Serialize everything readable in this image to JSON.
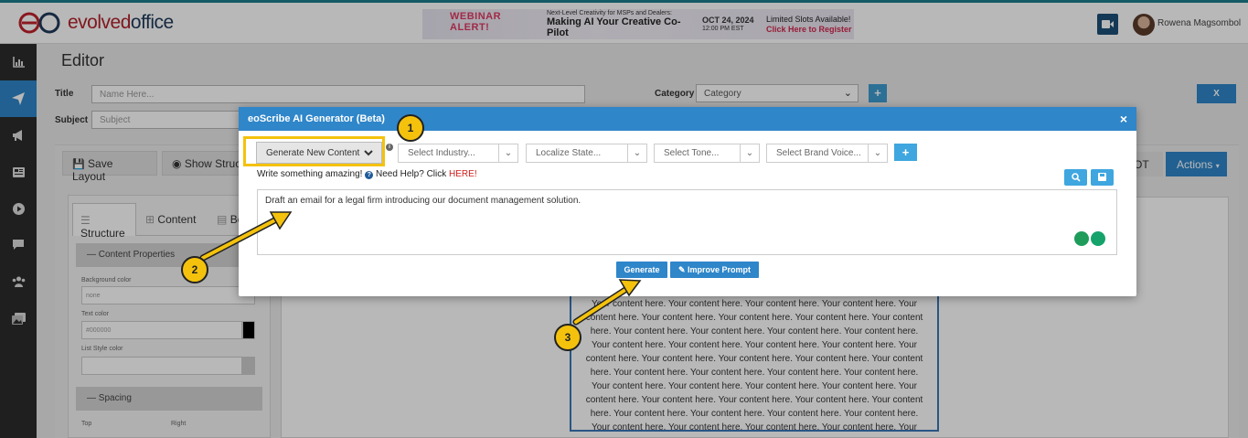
{
  "brand": {
    "name_part1": "evolved",
    "name_part2": "office"
  },
  "banner": {
    "alert_line1": "WEBINAR",
    "alert_line2": "ALERT!",
    "subtitle": "Next-Level Creativity for MSPs and Dealers:",
    "headline": "Making AI Your Creative Co-Pilot",
    "date": "OCT 24, 2024",
    "time": "12:00 PM EST",
    "cta_line1": "Limited Slots Available!",
    "cta_line2": "Click Here to Register"
  },
  "user": {
    "name": "Rowena Magsombol"
  },
  "sidebar": {
    "items": [
      {
        "name": "chart-icon",
        "glyph": "📊",
        "active": false
      },
      {
        "name": "send-icon",
        "glyph": "➤",
        "active": true
      },
      {
        "name": "megaphone-icon",
        "glyph": "📢",
        "active": false
      },
      {
        "name": "newspaper-icon",
        "glyph": "▤",
        "active": false
      },
      {
        "name": "play-icon",
        "glyph": "▶",
        "active": false
      },
      {
        "name": "chat-icon",
        "glyph": "▰",
        "active": false
      },
      {
        "name": "users-icon",
        "glyph": "👥",
        "active": false
      },
      {
        "name": "images-icon",
        "glyph": "🖼",
        "active": false
      }
    ]
  },
  "editor": {
    "page_title": "Editor",
    "title_label": "Title",
    "title_placeholder": "Name Here...",
    "subject_label": "Subject",
    "subject_placeholder": "Subject",
    "category_label": "Category",
    "category_value": "Category",
    "add_label": "+",
    "close_label": "X",
    "save_layout": "Save Layout",
    "show_structure": "Show Structure",
    "ot_label": "OT",
    "actions_label": "Actions"
  },
  "left_panel": {
    "tabs": [
      "Structure",
      "Content",
      "Bo"
    ],
    "content_properties": "Content Properties",
    "background_color_label": "Background color",
    "background_color_value": "none",
    "text_color_label": "Text color",
    "text_color_value": "#000000",
    "list_style_color_label": "List Style color",
    "spacing_label": "Spacing",
    "top_label": "Top",
    "right_label": "Right"
  },
  "canvas": {
    "content_text": "Your content here. Your content here. Your content here. Your content here. Your content here. Your content here. Your content here. Your content here. Your content here. Your content here. Your content here. Your content here. Your content here. Your content here. Your content here. Your content here. Your content here. Your content here. Your content here. Your content here. Your content here. Your content here. Your content here. Your content here. Your content here. Your content here. Your content here. Your content here. Your content here. Your content here. Your content here. Your content here. Your content here. Your content here. Your content here. Your content here. Your content here. Your content here. Your content here. Your content here. Your content here. Your content here. Your content here. Your content here. Your content here. Your content here. Your content here. Your content here. Your content here. Your content here. Your content here. Your content here. Your content here. Your content here. Your content here. Your content here."
  },
  "modal": {
    "title": "eoScribe AI Generator (Beta)",
    "close": "×",
    "mode_value": "Generate New Content",
    "industry_placeholder": "Select Industry...",
    "state_placeholder": "Localize State...",
    "tone_placeholder": "Select Tone...",
    "voice_placeholder": "Select Brand Voice...",
    "add_label": "+",
    "help_text": "Write something amazing!",
    "help_question": "?",
    "help_link_prefix": "Need Help? Click",
    "help_link": "HERE!",
    "prompt_text": "Draft an email for a legal firm introducing our document management solution.",
    "generate_label": "Generate",
    "improve_label": "Improve Prompt"
  },
  "callouts": {
    "one": "1",
    "two": "2",
    "three": "3"
  },
  "colors": {
    "primary": "#2f86c9",
    "highlight": "#f4c20d",
    "sidebar": "#2b2b2b"
  }
}
